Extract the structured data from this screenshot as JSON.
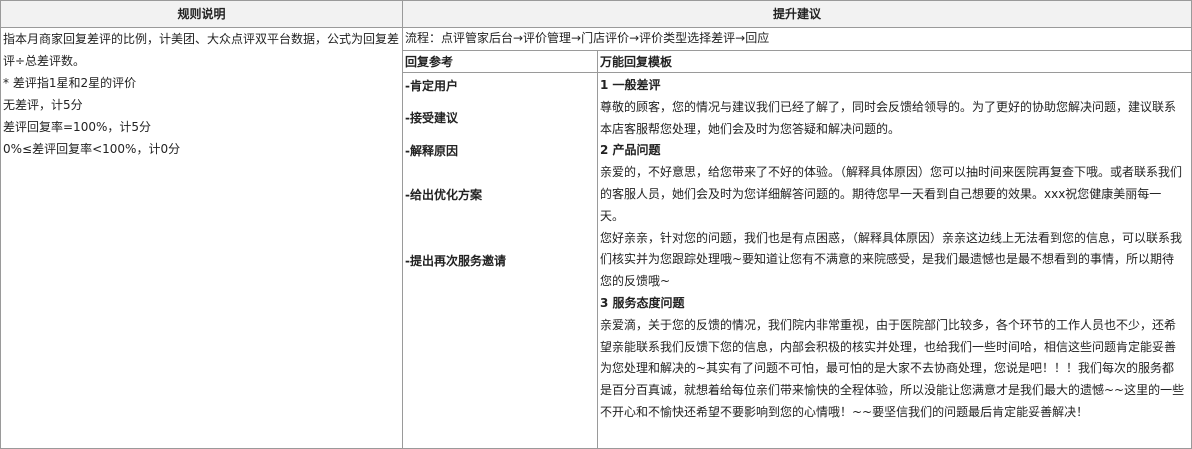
{
  "headers": {
    "rules": "规则说明",
    "suggestion": "提升建议"
  },
  "rules": {
    "lines": [
      "指本月商家回复差评的比例，计美团、大众点评双平台数据，公式为回复差评÷总差评数。",
      "* 差评指1星和2星的评价",
      "无差评，计5分",
      "差评回复率=100%，计5分",
      "0%≤差评回复率<100%，计0分"
    ]
  },
  "flow": "流程：点评管家后台→评价管理→门店评价→评价类型选择差评→回应",
  "sub_headers": {
    "reference": "回复参考",
    "template": "万能回复模板"
  },
  "reference_items": [
    "-肯定用户",
    "-接受建议",
    "-解释原因",
    "-给出优化方案",
    "-提出再次服务邀请"
  ],
  "templates": [
    {
      "heading": "1 一般差评",
      "paragraphs": [
        "尊敬的顾客，您的情况与建议我们已经了解了，同时会反馈给领导的。为了更好的协助您解决问题，建议联系本店客服帮您处理，她们会及时为您答疑和解决问题的。"
      ]
    },
    {
      "heading": "2 产品问题",
      "paragraphs": [
        "亲爱的，不好意思，给您带来了不好的体验。（解释具体原因）您可以抽时间来医院再复查下哦。或者联系我们的客服人员，她们会及时为您详细解答问题的。期待您早一天看到自己想要的效果。xxx祝您健康美丽每一天。",
        "您好亲亲，针对您的问题，我们也是有点困惑，（解释具体原因）亲亲这边线上无法看到您的信息，可以联系我们核实并为您跟踪处理哦~要知道让您有不满意的来院感受，是我们最遗憾也是最不想看到的事情，所以期待您的反馈哦~"
      ]
    },
    {
      "heading": "3 服务态度问题",
      "paragraphs": [
        "亲爱滴，关于您的反馈的情况，我们院内非常重视，由于医院部门比较多，各个环节的工作人员也不少，还希望亲能联系我们反馈下您的信息，内部会积极的核实并处理，也给我们一些时间哈，相信这些问题肯定能妥善为您处理和解决的~其实有了问题不可怕，最可怕的是大家不去协商处理，您说是吧！！！我们每次的服务都是百分百真诚，就想着给每位亲们带来愉快的全程体验，所以没能让您满意才是我们最大的遗憾~~这里的一些不开心和不愉快还希望不要影响到您的心情哦！~~要坚信我们的问题最后肯定能妥善解决！"
      ]
    }
  ]
}
